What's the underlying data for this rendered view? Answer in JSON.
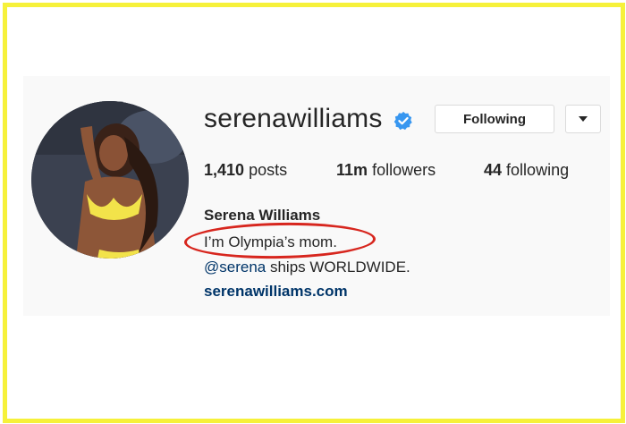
{
  "profile": {
    "username": "serenawilliams",
    "verified": true,
    "follow_button": "Following",
    "dropdown_icon": "caret-down-icon"
  },
  "stats": {
    "posts_count": "1,410",
    "posts_label": "posts",
    "followers_count": "11m",
    "followers_label": "followers",
    "following_count": "44",
    "following_label": "following"
  },
  "bio": {
    "full_name": "Serena Williams",
    "line1": "I’m Olympia’s mom.",
    "line2_mention": "@serena",
    "line2_rest": " ships WORLDWIDE.",
    "website": "serenawilliams.com"
  },
  "colors": {
    "frame_yellow": "#f6f13a",
    "annotation_red": "#d7261e",
    "verified_blue": "#3897f0",
    "link_blue": "#003569"
  }
}
